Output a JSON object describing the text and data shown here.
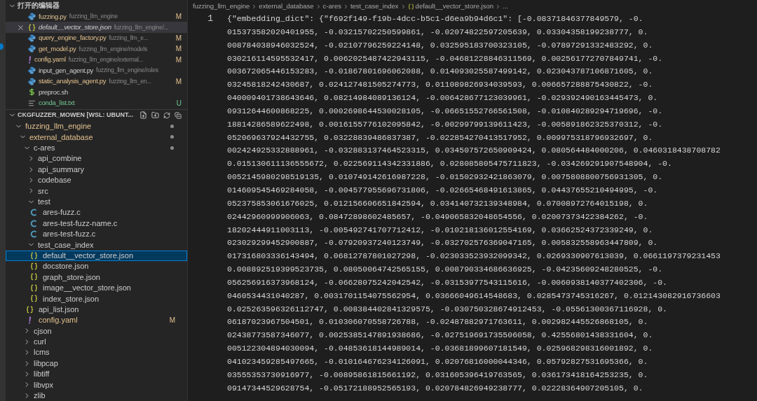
{
  "activity_bar": {
    "badge": true
  },
  "open_editors": {
    "title": "打开的编辑器",
    "expanded": true,
    "items": [
      {
        "name": "fuzzing.py",
        "path": "fuzzing_llm_engine",
        "kind": "python",
        "modified": true,
        "untracked": false,
        "status": "M",
        "selected": false
      },
      {
        "name": "default__vector_store.json",
        "path": "fuzzing_llm_engine/...",
        "kind": "json",
        "modified": false,
        "untracked": false,
        "selected": true
      },
      {
        "name": "query_engine_factory.py",
        "path": "fuzzing_llm_e...",
        "kind": "python",
        "modified": true,
        "untracked": false,
        "status": "M",
        "selected": false
      },
      {
        "name": "get_model.py",
        "path": "fuzzing_llm_engine/models",
        "kind": "python",
        "modified": true,
        "untracked": false,
        "status": "M",
        "selected": false
      },
      {
        "name": "config.yaml",
        "path": "fuzzing_llm_engine/external...",
        "kind": "yaml",
        "modified": true,
        "untracked": false,
        "status": "M",
        "selected": false
      },
      {
        "name": "input_gen_agent.py",
        "path": "fuzzing_llm_engine/roles",
        "kind": "python",
        "modified": false,
        "untracked": false,
        "selected": false
      },
      {
        "name": "static_analysis_agent.py",
        "path": "fuzzing_llm_en...",
        "kind": "python",
        "modified": true,
        "untracked": false,
        "status": "M",
        "selected": false
      },
      {
        "name": "preproc.sh",
        "kind": "shell",
        "modified": false,
        "untracked": false,
        "selected": false
      },
      {
        "name": "conda_list.txt",
        "kind": "text",
        "modified": false,
        "untracked": true,
        "status": "U",
        "selected": false
      }
    ]
  },
  "explorer": {
    "title": "CKGFUZZER_MOWEN [WSL: UBUNT...",
    "expanded": true,
    "tree": [
      {
        "name": "fuzzing_llm_engine",
        "kind": "folder",
        "expanded": true,
        "modified": true,
        "dot": true,
        "selected": false,
        "children": [
          {
            "name": "external_database",
            "kind": "folder",
            "expanded": true,
            "modified": true,
            "dot": true,
            "selected": false,
            "children": [
              {
                "name": "c-ares",
                "kind": "folder",
                "expanded": true,
                "modified": false,
                "dot": true,
                "selected": false,
                "children": [
                  {
                    "name": "api_combine",
                    "kind": "folder",
                    "expanded": false,
                    "modified": false,
                    "selected": false
                  },
                  {
                    "name": "api_summary",
                    "kind": "folder",
                    "expanded": false,
                    "modified": false,
                    "selected": false
                  },
                  {
                    "name": "codebase",
                    "kind": "folder",
                    "expanded": false,
                    "modified": false,
                    "selected": false
                  },
                  {
                    "name": "src",
                    "kind": "folder",
                    "expanded": false,
                    "modified": false,
                    "selected": false
                  },
                  {
                    "name": "test",
                    "kind": "folder",
                    "expanded": true,
                    "modified": false,
                    "selected": false,
                    "children": [
                      {
                        "name": "ares-fuzz.c",
                        "kind": "c",
                        "modified": false,
                        "selected": false
                      },
                      {
                        "name": "ares-test-fuzz-name.c",
                        "kind": "c",
                        "modified": false,
                        "selected": false
                      },
                      {
                        "name": "ares-test-fuzz.c",
                        "kind": "c",
                        "modified": false,
                        "selected": false
                      }
                    ]
                  },
                  {
                    "name": "test_case_index",
                    "kind": "folder",
                    "expanded": true,
                    "modified": false,
                    "selected": false,
                    "children": [
                      {
                        "name": "default__vector_store.json",
                        "kind": "json",
                        "modified": false,
                        "selected": true
                      },
                      {
                        "name": "docstore.json",
                        "kind": "json",
                        "modified": false,
                        "selected": false
                      },
                      {
                        "name": "graph_store.json",
                        "kind": "json",
                        "modified": false,
                        "selected": false
                      },
                      {
                        "name": "image__vector_store.json",
                        "kind": "json",
                        "modified": false,
                        "selected": false
                      },
                      {
                        "name": "index_store.json",
                        "kind": "json",
                        "modified": false,
                        "selected": false
                      }
                    ]
                  },
                  {
                    "name": "api_list.json",
                    "kind": "json",
                    "modified": false,
                    "selected": false
                  },
                  {
                    "name": "config.yaml",
                    "kind": "yaml",
                    "modified": true,
                    "status": "M",
                    "selected": false
                  }
                ]
              },
              {
                "name": "cjson",
                "kind": "folder",
                "expanded": false,
                "modified": false,
                "selected": false
              },
              {
                "name": "curl",
                "kind": "folder",
                "expanded": false,
                "modified": false,
                "selected": false
              },
              {
                "name": "lcms",
                "kind": "folder",
                "expanded": false,
                "modified": false,
                "selected": false
              },
              {
                "name": "libpcap",
                "kind": "folder",
                "expanded": false,
                "modified": false,
                "selected": false
              },
              {
                "name": "libtiff",
                "kind": "folder",
                "expanded": false,
                "modified": false,
                "selected": false
              },
              {
                "name": "libvpx",
                "kind": "folder",
                "expanded": false,
                "modified": false,
                "selected": false
              },
              {
                "name": "zlib",
                "kind": "folder",
                "expanded": false,
                "modified": false,
                "selected": false
              }
            ]
          }
        ]
      }
    ]
  },
  "editor": {
    "breadcrumbs": [
      {
        "label": "fuzzing_llm_engine",
        "kind": "folder"
      },
      {
        "label": "external_database",
        "kind": "folder"
      },
      {
        "label": "c-ares",
        "kind": "folder"
      },
      {
        "label": "test_case_index",
        "kind": "folder"
      },
      {
        "label": "default__vector_store.json",
        "kind": "json"
      },
      {
        "label": "...",
        "kind": "more"
      }
    ],
    "lines": [
      {
        "number": "1",
        "text": "{\"embedding_dict\": {\"f692f149-f19b-4dcc-b5c1-d6ea9b94d6c1\": [-0.08371846377849579, -0."
      },
      {
        "text": "015373582020401955, -0.03215702250599861, -0.02074822597205639, 0.03304358199238777, 0."
      },
      {
        "text": "008784038946032524, -0.02107796259224148, 0.032595183700323105, -0.07897291332483292, 0."
      },
      {
        "text": "030216114595532417, 0.0062025487422943115, -0.04681228846311569, 0.002561772707849741, -0."
      },
      {
        "text": "003672065446153283, -0.01867801696062088, 0.014093025587499142, 0.023043787106871605, 0."
      },
      {
        "text": "03245818242430687, 0.024127481505274773, 0.011089826934039593, 0.006657288875430822, -0."
      },
      {
        "text": "040009401738643646, 0.08214984089136124, -0.006428677123039961, -0.029392490163445473, 0."
      },
      {
        "text": "09312644600868225, 0.0002698644530028105, -0.06651552766561508, -0.010840289294719696, -0."
      },
      {
        "text": "18814286589622498, 0.0016155776102095842, -0.00299799139611423, -0.005891862325370312, -0."
      },
      {
        "text": "052069637924432755, 0.03228839486837387, -0.022854270413517952, 0.009975318796932697, 0."
      },
      {
        "text": "002424925332888961, -0.032883137464523315, 0.034507572650909424, 0.080564484000206, 0.0460318438708782"
      },
      {
        "text": "0.015130611136555672, 0.022569114342331886, 0.028085805475711823, -0.034269291907548904, -0."
      },
      {
        "text": "0052145980298519135, 0.010749142616987228, -0.01502932421863079, 0.0075808800756931305, 0."
      },
      {
        "text": "014609545469284058, -0.004577955696731806, -0.02665468491613865, 0.04437655210494995, -0."
      },
      {
        "text": "052375853061676025, 0.012156606651842594, 0.034140732139348984, 0.07008972764015198, 0."
      },
      {
        "text": "02442960999906063, 0.08472898602485657, -0.049065832048654556, 0.02007373422384262, -0."
      },
      {
        "text": "18202444911003113, -0.005492741707712412, -0.010218136012554169, 0.03662524372339249, 0."
      },
      {
        "text": "023029299452900887, -0.07920937240123749, -0.032702576369047165, 0.005832558963447809, 0."
      },
      {
        "text": "017316803336143494, 0.06812787801027298, -0.023033523932099342, 0.0269330907613039, 0.0661197379231453"
      },
      {
        "text": "0.008892519399523735, 0.08050064742565155, 0.008790334686636925, -0.04235609248280525, -0."
      },
      {
        "text": "056256916373968124, -0.06628075242042542, -0.03153977543115616, -0.0060938140377402306, -0."
      },
      {
        "text": "0460534431040287, 0.0031701154075562954, 0.03666049614548683, 0.0285473745316267, 0.012143082916736603"
      },
      {
        "text": "0.025263596326112747, 0.008384402841329575, -0.030750328674912453, -0.05561300367116928, 0."
      },
      {
        "text": "06187023967504501, 0.010306070558726788, -0.02487882971763611, 0.002982445526868105, 0."
      },
      {
        "text": "02438773587346077, 0.0025385147891938686, -0.027519691735506058, 0.42556801438331604, 0."
      },
      {
        "text": "005122304894030094, -0.04853618144989014, -0.03681899607181549, 0.025968298316001892, 0."
      },
      {
        "text": "041023459285497665, -0.010164676234126091, 0.02076816000044346, 0.05792827531695366, 0."
      },
      {
        "text": "03555353730916977, -0.00895861815661192, 0.031605396419763565, 0.036173418164253235, 0."
      },
      {
        "text": "09147344529628754, -0.05172188952565193, 0.020784826949238777, 0.02228364907205105, 0."
      }
    ]
  }
}
